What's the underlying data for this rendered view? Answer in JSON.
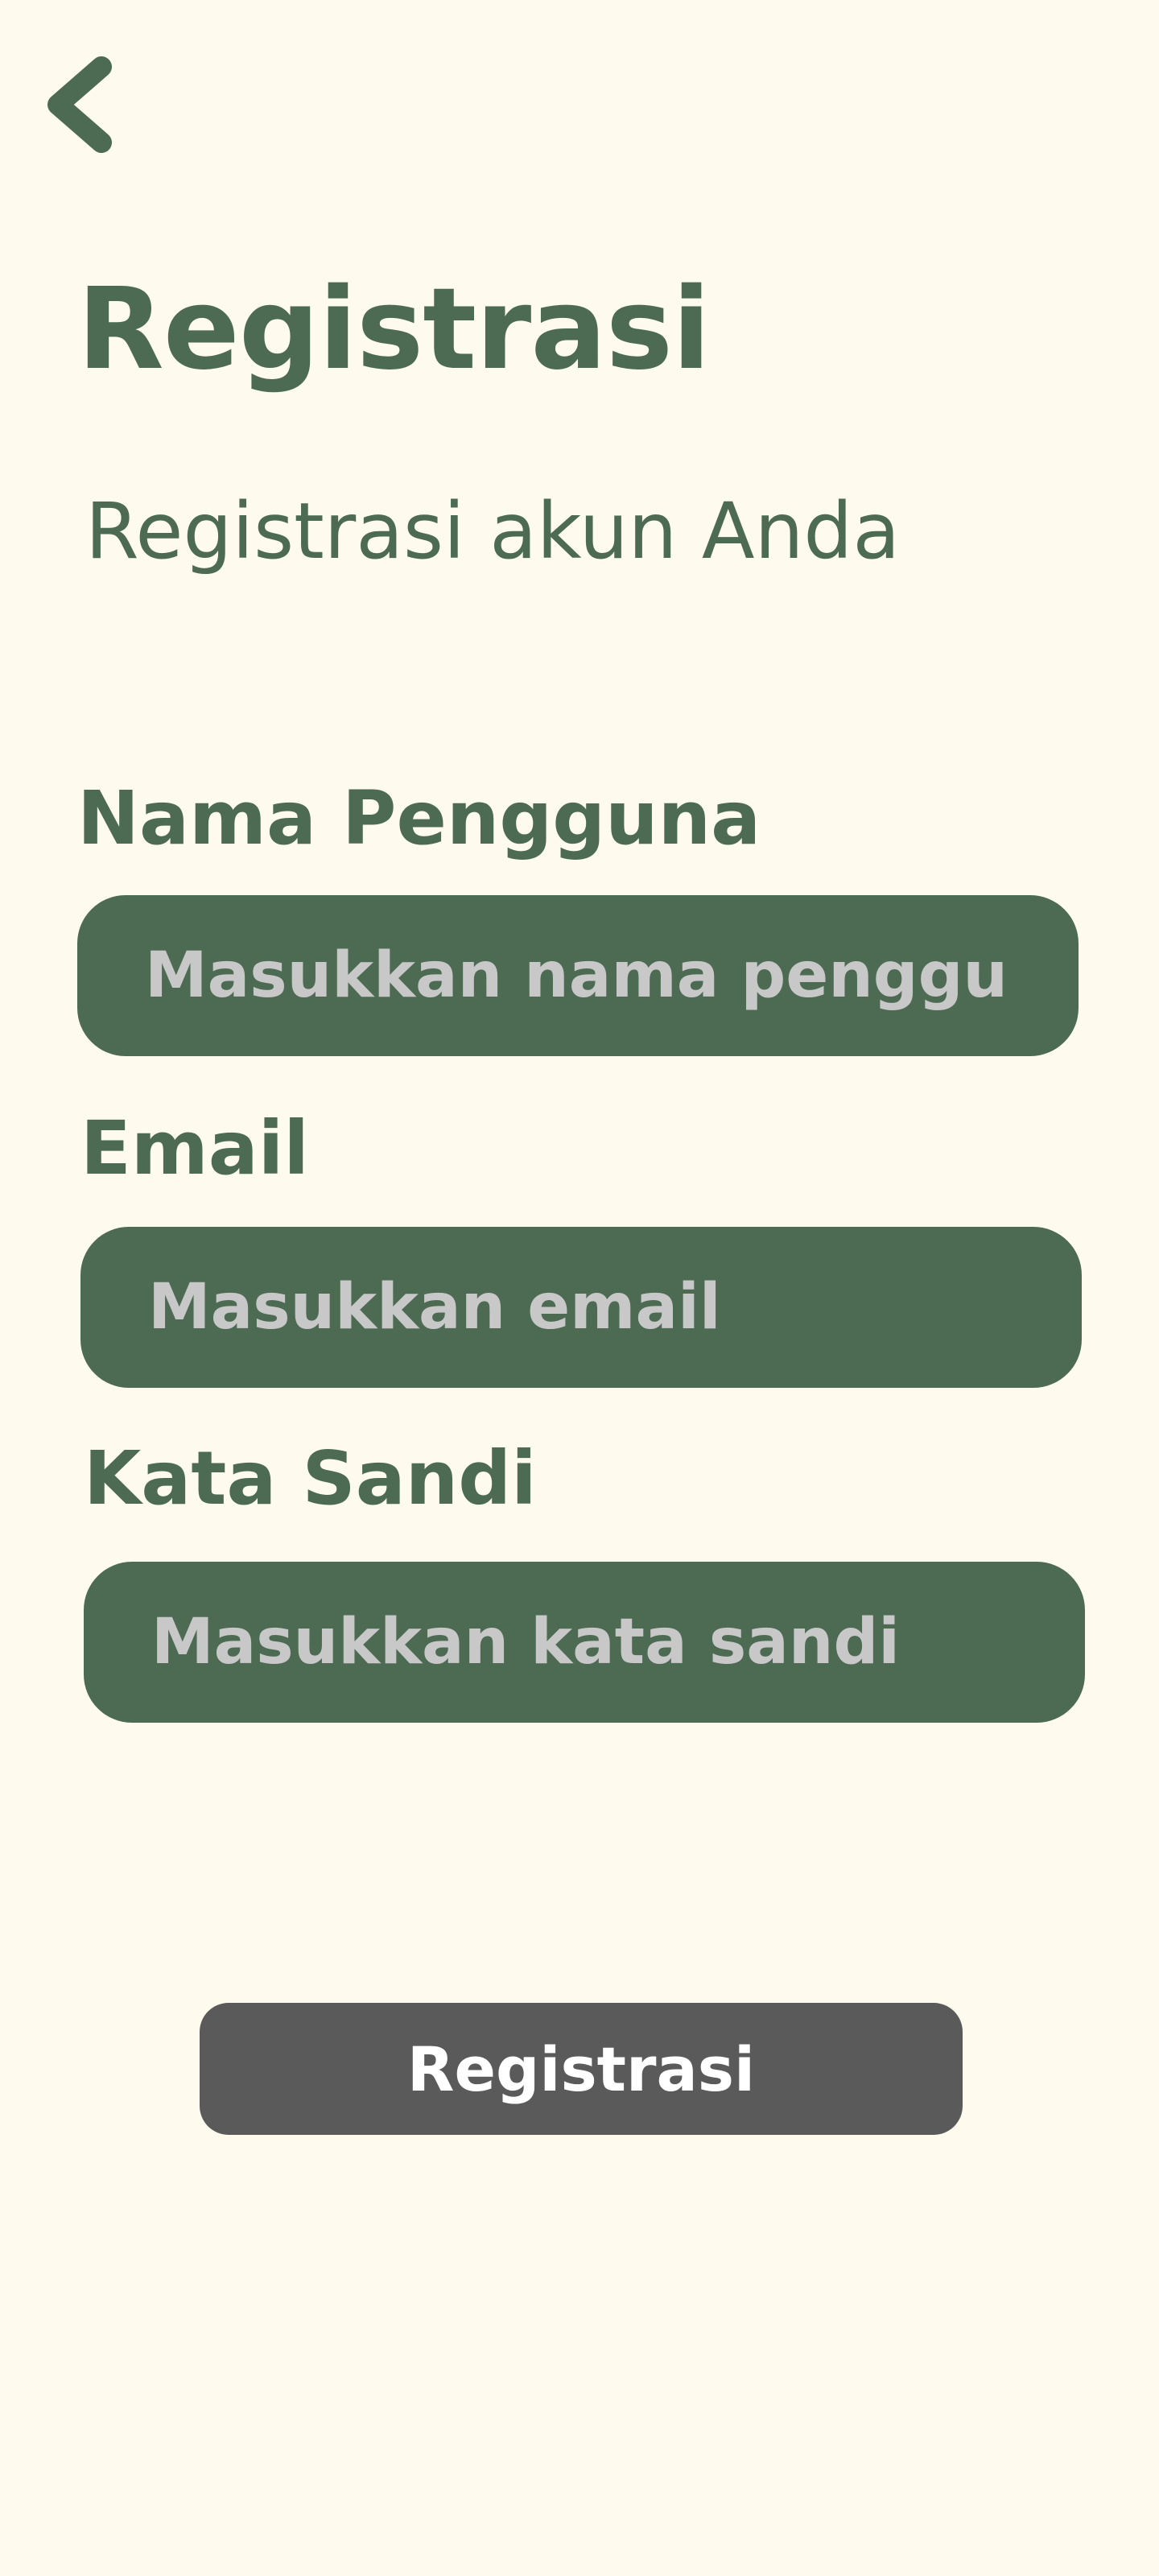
{
  "header": {
    "back_icon": "chevron-left-icon",
    "title": "Registrasi",
    "subtitle": "Registrasi akun Anda"
  },
  "form": {
    "username": {
      "label": "Nama Pengguna",
      "value": "",
      "placeholder": "Masukkan nama pengguna"
    },
    "email": {
      "label": "Email",
      "value": "",
      "placeholder": "Masukkan email"
    },
    "password": {
      "label": "Kata Sandi",
      "value": "",
      "placeholder": "Masukkan kata sandi"
    }
  },
  "actions": {
    "submit_label": "Registrasi"
  },
  "colors": {
    "background": "#fefaee",
    "primary_green": "#4d6b53",
    "placeholder_gray": "#c8c8c8",
    "button_gray": "#5a5a5a",
    "button_text": "#ffffff"
  }
}
